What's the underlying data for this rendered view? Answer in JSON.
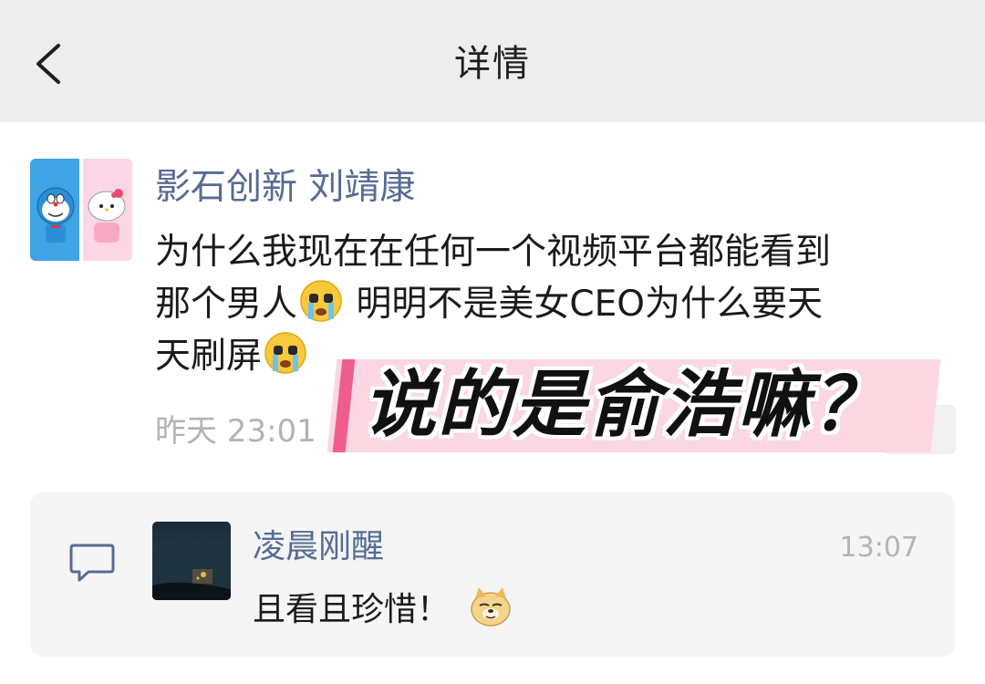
{
  "header": {
    "back_icon": "chevron-left-icon",
    "title": "详情"
  },
  "post": {
    "author": "影石创新 刘靖康",
    "content_lines": [
      "为什么我现在在任何一个视频平台都能看到",
      "那个男人",
      " 明明不是美女CEO为什么要天",
      "天刷屏"
    ],
    "inline_emoji": "crying-face-emoji",
    "timestamp": "昨天 23:01",
    "overlay_caption": "说的是俞浩嘛？",
    "colors": {
      "name_blue": "#556b95",
      "overlay_pink": "#fbd7e2",
      "overlay_bar": "#ef5d8e"
    }
  },
  "comments": {
    "icon": "comment-bubble-icon",
    "items": [
      {
        "name": "凌晨刚醒",
        "time": "13:07",
        "text": "且看且珍惜！",
        "emoji": "doge-emoji"
      }
    ]
  }
}
